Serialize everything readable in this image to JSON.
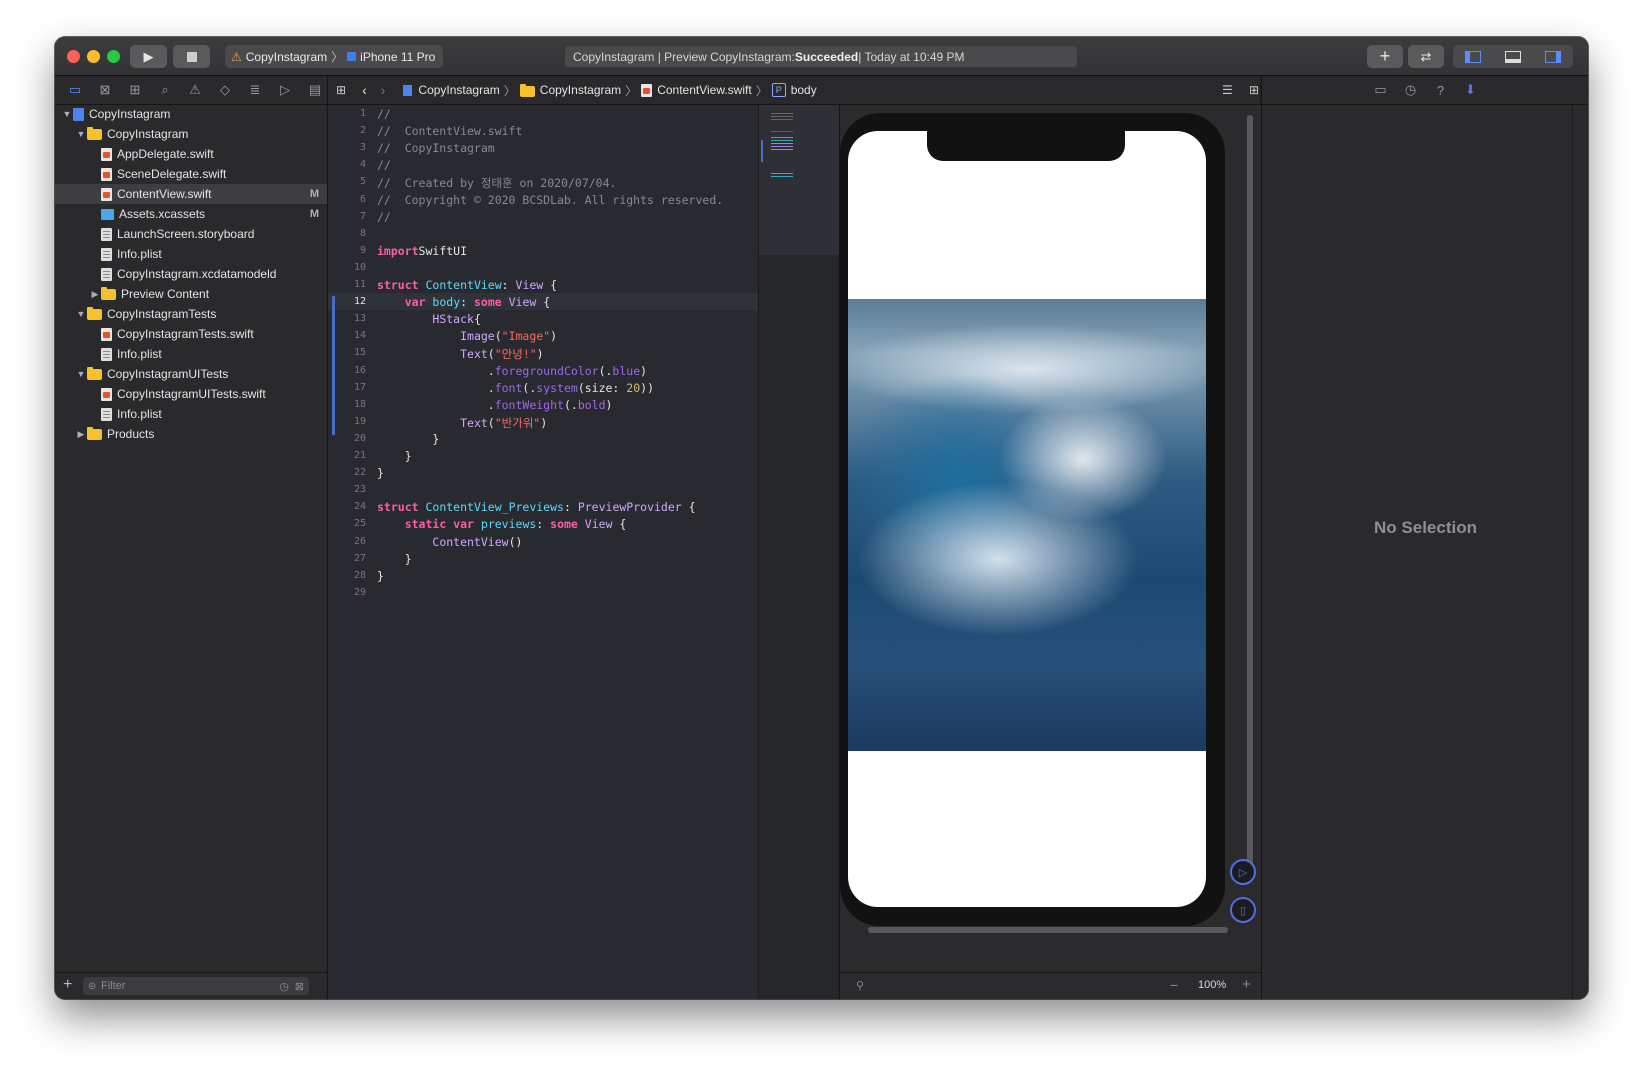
{
  "colors": {
    "accent": "#5b8cf7",
    "close": "#ff5f57",
    "minimize": "#febc2e",
    "zoom": "#28c840"
  },
  "toolbar": {
    "scheme_name": "CopyInstagram",
    "device_name": "iPhone 11 Pro",
    "activity_prefix": "CopyInstagram | Preview CopyInstagram: ",
    "activity_status": "Succeeded",
    "activity_time": " | Today at 10:49 PM",
    "add_icon": "plus-icon",
    "back_forward_icon": "arrows-icon"
  },
  "navigator": {
    "items": [
      {
        "label": "CopyInstagram",
        "type": "proj",
        "indent": 0,
        "disclosure": "▼"
      },
      {
        "label": "CopyInstagram",
        "type": "folder",
        "indent": 1,
        "disclosure": "▼"
      },
      {
        "label": "AppDelegate.swift",
        "type": "swift",
        "indent": 2,
        "disclosure": ""
      },
      {
        "label": "SceneDelegate.swift",
        "type": "swift",
        "indent": 2,
        "disclosure": ""
      },
      {
        "label": "ContentView.swift",
        "type": "swift",
        "indent": 2,
        "disclosure": "",
        "badge": "M",
        "selected": true
      },
      {
        "label": "Assets.xcassets",
        "type": "assets",
        "indent": 2,
        "disclosure": "",
        "badge": "M"
      },
      {
        "label": "LaunchScreen.storyboard",
        "type": "plist",
        "indent": 2,
        "disclosure": ""
      },
      {
        "label": "Info.plist",
        "type": "plist",
        "indent": 2,
        "disclosure": ""
      },
      {
        "label": "CopyInstagram.xcdatamodeld",
        "type": "plist",
        "indent": 2,
        "disclosure": ""
      },
      {
        "label": "Preview Content",
        "type": "folder",
        "indent": 2,
        "disclosure": "▶"
      },
      {
        "label": "CopyInstagramTests",
        "type": "folder",
        "indent": 1,
        "disclosure": "▼"
      },
      {
        "label": "CopyInstagramTests.swift",
        "type": "swift",
        "indent": 2,
        "disclosure": ""
      },
      {
        "label": "Info.plist",
        "type": "plist",
        "indent": 2,
        "disclosure": ""
      },
      {
        "label": "CopyInstagramUITests",
        "type": "folder",
        "indent": 1,
        "disclosure": "▼"
      },
      {
        "label": "CopyInstagramUITests.swift",
        "type": "swift",
        "indent": 2,
        "disclosure": ""
      },
      {
        "label": "Info.plist",
        "type": "plist",
        "indent": 2,
        "disclosure": ""
      },
      {
        "label": "Products",
        "type": "folder",
        "indent": 1,
        "disclosure": "▶"
      }
    ],
    "filter_placeholder": "Filter"
  },
  "jumpbar": {
    "crumbs": [
      "CopyInstagram",
      "CopyInstagram",
      "ContentView.swift",
      "body"
    ]
  },
  "editor": {
    "current_line": 12,
    "lines": [
      [
        [
          "c-cm",
          "//"
        ]
      ],
      [
        [
          "c-cm",
          "//  ContentView.swift"
        ]
      ],
      [
        [
          "c-cm",
          "//  CopyInstagram"
        ]
      ],
      [
        [
          "c-cm",
          "//"
        ]
      ],
      [
        [
          "c-cm",
          "//  Created by 정태훈 on 2020/07/04."
        ]
      ],
      [
        [
          "c-cm",
          "//  Copyright © 2020 BCSDLab. All rights reserved."
        ]
      ],
      [
        [
          "c-cm",
          "//"
        ]
      ],
      [],
      [
        [
          "c-kw",
          "import"
        ],
        [
          "",
          "SwiftUI"
        ]
      ],
      [],
      [
        [
          "c-kw",
          "struct"
        ],
        [
          "",
          " "
        ],
        [
          "c-ty",
          "ContentView"
        ],
        [
          "",
          ": "
        ],
        [
          "c-ty2",
          "View"
        ],
        [
          "",
          " {"
        ]
      ],
      [
        [
          "",
          "    "
        ],
        [
          "c-kw",
          "var"
        ],
        [
          "",
          " "
        ],
        [
          "c-ty",
          "body"
        ],
        [
          "",
          ": "
        ],
        [
          "c-kw",
          "some"
        ],
        [
          "",
          " "
        ],
        [
          "c-ty2",
          "View"
        ],
        [
          "",
          " {"
        ]
      ],
      [
        [
          "",
          "        "
        ],
        [
          "c-ty2",
          "HStack"
        ],
        [
          "",
          "{"
        ]
      ],
      [
        [
          "",
          "            "
        ],
        [
          "c-ty2",
          "Image"
        ],
        [
          "",
          "("
        ],
        [
          "c-st",
          "\"Image\""
        ],
        [
          "",
          ")"
        ]
      ],
      [
        [
          "",
          "            "
        ],
        [
          "c-ty2",
          "Text"
        ],
        [
          "",
          "("
        ],
        [
          "c-st",
          "\"안녕!\""
        ],
        [
          "",
          ")"
        ]
      ],
      [
        [
          "",
          "                ."
        ],
        [
          "c-fn",
          "foregroundColor"
        ],
        [
          "",
          "(."
        ],
        [
          "c-fn",
          "blue"
        ],
        [
          "",
          ")"
        ]
      ],
      [
        [
          "",
          "                ."
        ],
        [
          "c-fn",
          "font"
        ],
        [
          "",
          "(."
        ],
        [
          "c-fn",
          "system"
        ],
        [
          "",
          "(size: "
        ],
        [
          "c-nm",
          "20"
        ],
        [
          "",
          "))"
        ]
      ],
      [
        [
          "",
          "                ."
        ],
        [
          "c-fn",
          "fontWeight"
        ],
        [
          "",
          "(."
        ],
        [
          "c-fn",
          "bold"
        ],
        [
          "",
          ")"
        ]
      ],
      [
        [
          "",
          "            "
        ],
        [
          "c-ty2",
          "Text"
        ],
        [
          "",
          "("
        ],
        [
          "c-st",
          "\"반가워\""
        ],
        [
          "",
          ")"
        ]
      ],
      [
        [
          "",
          "        }"
        ]
      ],
      [
        [
          "",
          "    }"
        ]
      ],
      [
        [
          "",
          "}"
        ]
      ],
      [],
      [
        [
          "c-kw",
          "struct"
        ],
        [
          "",
          " "
        ],
        [
          "c-ty",
          "ContentView_Previews"
        ],
        [
          "",
          ": "
        ],
        [
          "c-ty2",
          "PreviewProvider"
        ],
        [
          "",
          " {"
        ]
      ],
      [
        [
          "",
          "    "
        ],
        [
          "c-kw",
          "static"
        ],
        [
          "",
          " "
        ],
        [
          "c-kw",
          "var"
        ],
        [
          "",
          " "
        ],
        [
          "c-ty",
          "previews"
        ],
        [
          "",
          ": "
        ],
        [
          "c-kw",
          "some"
        ],
        [
          "",
          " "
        ],
        [
          "c-ty2",
          "View"
        ],
        [
          "",
          " {"
        ]
      ],
      [
        [
          "",
          "        "
        ],
        [
          "c-ty2",
          "ContentView"
        ],
        [
          "",
          "()"
        ]
      ],
      [
        [
          "",
          "    }"
        ]
      ],
      [
        [
          "",
          "}"
        ]
      ],
      []
    ]
  },
  "canvas": {
    "zoom": "100%",
    "live_preview_icon": "play-circle-icon",
    "device_icon": "device-circle-icon"
  },
  "inspector": {
    "empty_text": "No Selection"
  }
}
